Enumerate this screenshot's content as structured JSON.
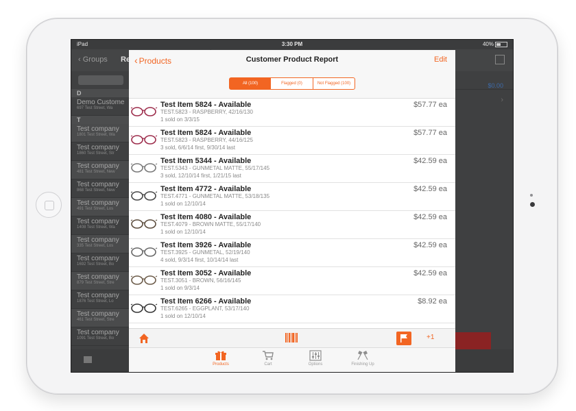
{
  "status_bar": {
    "device": "iPad",
    "time": "3:30 PM",
    "battery": "40%"
  },
  "background": {
    "back_label": "Groups",
    "title_partial": "Re",
    "letters": [
      "D",
      "T"
    ],
    "rows": [
      {
        "name": "Demo Custome",
        "address": "697 Test Street, Wa"
      },
      {
        "name": "Test company",
        "address": "1801 Test Street, Wa"
      },
      {
        "name": "Test company",
        "address": "1860 Test Street, Str"
      },
      {
        "name": "Test company",
        "address": "481 Test Street, New"
      },
      {
        "name": "Test company",
        "address": "868 Test Street, New"
      },
      {
        "name": "Test company",
        "address": "491 Test Street, Los"
      },
      {
        "name": "Test company",
        "address": "1408 Test Street, Wa"
      },
      {
        "name": "Test company",
        "address": "335 Test Street, Los"
      },
      {
        "name": "Test company",
        "address": "1692 Test Street, Bo"
      },
      {
        "name": "Test company",
        "address": "879 Test Street, Stre"
      },
      {
        "name": "Test company",
        "address": "1876 Test Street, Lo"
      },
      {
        "name": "Test company",
        "address": "461 Test Street, Stre"
      },
      {
        "name": "Test company",
        "address": "1091 Test Street, Bo"
      }
    ],
    "amount": "$0.00"
  },
  "modal": {
    "back_label": "Products",
    "title": "Customer Product Report",
    "edit_label": "Edit",
    "segments": [
      "All (100)",
      "Flagged (0)",
      "Not Flagged (100)"
    ],
    "items": [
      {
        "title": "Test Item 5824 - Available",
        "sku": "TEST.5823 - RASPBERRY, 42/16/130",
        "sold": "1 sold on 3/3/15",
        "price": "$57.77 ea",
        "frame_color": "#9c2b4a"
      },
      {
        "title": "Test Item 5824 - Available",
        "sku": "TEST.5823 - RASPBERRY, 44/16/125",
        "sold": "3 sold, 6/6/14 first, 9/30/14 last",
        "price": "$57.77 ea",
        "frame_color": "#9c2b4a"
      },
      {
        "title": "Test Item 5344 - Available",
        "sku": "TEST.5343 - GUNMETAL MATTE, 55/17/145",
        "sold": "3 sold, 12/10/14 first, 1/21/15 last",
        "price": "$42.59 ea",
        "frame_color": "#777777"
      },
      {
        "title": "Test Item 4772 - Available",
        "sku": "TEST.4771 - GUNMETAL MATTE, 53/18/135",
        "sold": "1 sold on 12/10/14",
        "price": "$42.59 ea",
        "frame_color": "#444444"
      },
      {
        "title": "Test Item 4080 - Available",
        "sku": "TEST.4079 - BROWN MATTE, 55/17/140",
        "sold": "1 sold on 12/10/14",
        "price": "$42.59 ea",
        "frame_color": "#5a4a3a"
      },
      {
        "title": "Test Item 3926 - Available",
        "sku": "TEST.3925 - GUNMETAL, 52/19/140",
        "sold": "4 sold, 9/3/14 first, 10/14/14 last",
        "price": "$42.59 ea",
        "frame_color": "#666666"
      },
      {
        "title": "Test Item 3052 - Available",
        "sku": "TEST.3051 - BROWN, 56/16/145",
        "sold": "1 sold on 9/3/14",
        "price": "$42.59 ea",
        "frame_color": "#6b5a48"
      },
      {
        "title": "Test Item 6266 - Available",
        "sku": "TEST.6265 - EGGPLANT, 53/17/140",
        "sold": "1 sold on 12/10/14",
        "price": "$8.92 ea",
        "frame_color": "#333333"
      }
    ],
    "toolbar": {
      "flag_count": "+1"
    },
    "tabs": [
      {
        "label": "Products",
        "icon": "gift-icon",
        "active": true
      },
      {
        "label": "Cart",
        "icon": "cart-icon",
        "active": false
      },
      {
        "label": "Options",
        "icon": "sliders-icon",
        "active": false
      },
      {
        "label": "Finishing Up",
        "icon": "checkered-flags-icon",
        "active": false
      }
    ],
    "accent_color": "#f26522"
  }
}
